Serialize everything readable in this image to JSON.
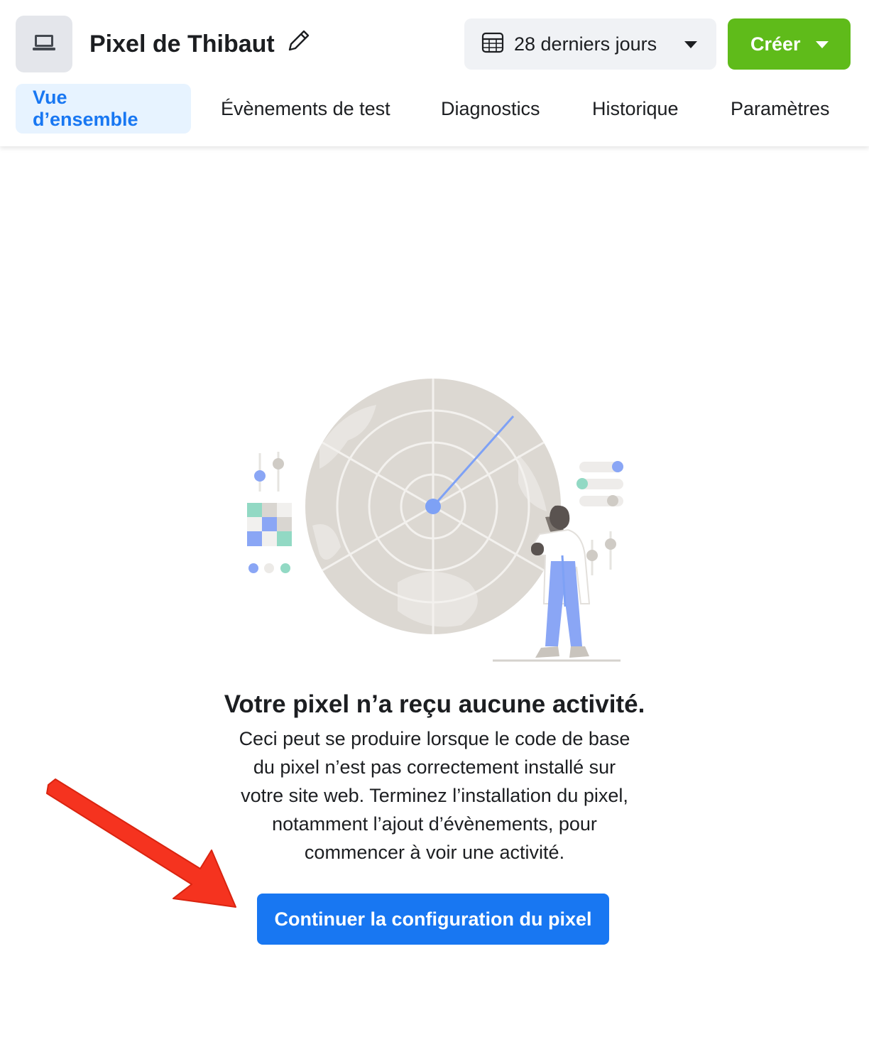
{
  "header": {
    "pixel_icon": "laptop-icon",
    "pixel_name": "Pixel de Thibaut",
    "edit_icon": "pencil-icon",
    "date_range": {
      "icon": "calendar-icon",
      "label": "28 derniers jours"
    },
    "create_button": {
      "label": "Créer",
      "color": "#5fbb1a"
    }
  },
  "tabs": [
    {
      "label": "Vue d’ensemble",
      "active": true
    },
    {
      "label": "Évènements de test",
      "active": false
    },
    {
      "label": "Diagnostics",
      "active": false
    },
    {
      "label": "Historique",
      "active": false
    },
    {
      "label": "Paramètres",
      "active": false
    }
  ],
  "empty_state": {
    "illustration": "radar-scientist-illustration",
    "title": "Votre pixel n’a reçu aucune activité.",
    "description_lines": [
      "Ceci peut se produire lorsque le code de base",
      "du pixel n’est pas correctement installé sur",
      "votre site web. Terminez l’installation du pixel,",
      "notamment l’ajout d’évènements, pour",
      "commencer à voir une activité."
    ],
    "cta_label": "Continuer la configuration du pixel"
  },
  "colors": {
    "accent": "#1877f2",
    "arrow": "#f5331f"
  }
}
